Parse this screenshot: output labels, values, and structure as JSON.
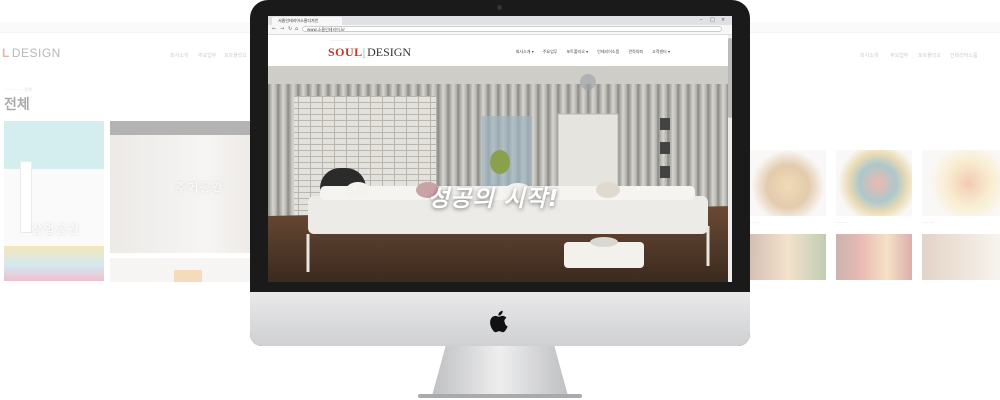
{
  "background_left": {
    "logo_mark": "L",
    "logo_text": "DESIGN",
    "breadcrumb": "········· ··· · 전체",
    "menu": [
      "회사소개",
      "주요업무",
      "포트폴리오",
      "인테리어소품"
    ],
    "page_title": "전체",
    "tiles": [
      {
        "label": "상업공간"
      },
      {
        "label": "주거공간"
      }
    ]
  },
  "background_right": {
    "menu": [
      "회사소개",
      "주요업무",
      "포트폴리오",
      "인테리어소품"
    ],
    "captions": [
      "·······",
      "··········",
      "··········"
    ]
  },
  "browser": {
    "tab_title": "서울인테리어소울디자인",
    "url": "www.소울인테리어.kr",
    "window_controls": [
      "–",
      "□",
      "×"
    ]
  },
  "site": {
    "logo_soul": "SOUL",
    "logo_design": "DESIGN",
    "logo_tagline": "·····················",
    "logo_sub": "····················",
    "menu": [
      {
        "label": "회사소개 ▾"
      },
      {
        "label": "주요업무"
      },
      {
        "label": "포트폴리오 ▾"
      },
      {
        "label": "인테리어소품"
      },
      {
        "label": "견적의뢰"
      },
      {
        "label": "고객센터 ▾"
      }
    ],
    "hero_text": "성공의 시작!",
    "prev_arrow": "‹",
    "next_arrow": "›"
  },
  "colors": {
    "brand_red": "#c0392b",
    "bezel": "#1a1a1a",
    "aluminum": "#d8d9db"
  },
  "icons": [
    "back-icon",
    "forward-icon",
    "reload-icon",
    "home-icon",
    "apple-logo-icon"
  ]
}
